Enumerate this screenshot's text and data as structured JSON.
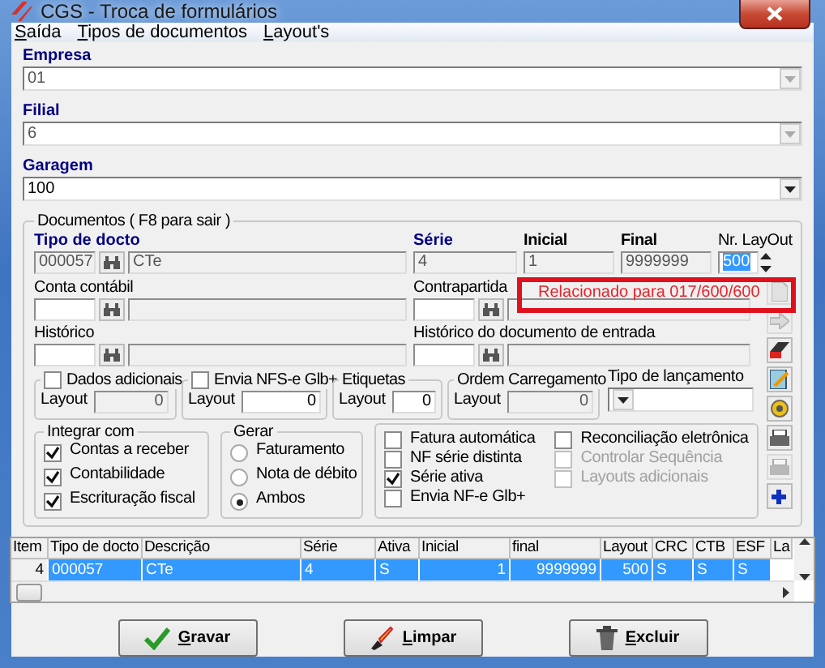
{
  "window": {
    "title": "CGS - Troca de formulários"
  },
  "menu": [
    {
      "label": "Saída"
    },
    {
      "label": "Tipos de documentos"
    },
    {
      "label": "Layout's"
    }
  ],
  "header_fields": [
    {
      "label": "Empresa",
      "value": "01",
      "disabled": true
    },
    {
      "label": "Filial",
      "value": "6",
      "disabled": true
    },
    {
      "label": "Garagem",
      "value": "100",
      "disabled": false
    }
  ],
  "documentos": {
    "title": "Documentos ( F8 para sair )",
    "tipo_docto": {
      "label": "Tipo de docto",
      "code": "000057",
      "description": "CTe"
    },
    "serie": {
      "label": "Série",
      "value": "4"
    },
    "inicial": {
      "label": "Inicial",
      "value": "1"
    },
    "final": {
      "label": "Final",
      "value": "9999999"
    },
    "nr_layout": {
      "label": "Nr. LayOut",
      "value": "500"
    },
    "notice": "Relacionado para 017/600/600",
    "conta_contabil": {
      "label": "Conta contábil"
    },
    "contrapartida": {
      "label": "Contrapartida"
    },
    "historico": {
      "label": "Histórico"
    },
    "historico_entrada": {
      "label": "Histórico do documento de entrada"
    },
    "layout_groups": [
      {
        "kind": "checkbox",
        "title": "Dados adicionais",
        "checked": false,
        "layout_label": "Layout",
        "value": "0",
        "disabled": true
      },
      {
        "kind": "checkbox",
        "title": "Envia NFS-e Glb+",
        "checked": false,
        "layout_label": "Layout",
        "value": "0",
        "disabled": false
      },
      {
        "kind": "plain",
        "title": "Etiquetas",
        "layout_label": "Layout",
        "value": "0",
        "disabled": false
      },
      {
        "kind": "plain",
        "title": "Ordem Carregamento",
        "layout_label": "Layout",
        "value": "0",
        "disabled": true
      }
    ],
    "tipo_lancamento": {
      "label": "Tipo de lançamento"
    },
    "integrar": {
      "title": "Integrar com",
      "items": [
        {
          "label": "Contas a receber",
          "checked": true
        },
        {
          "label": "Contabilidade",
          "checked": true
        },
        {
          "label": "Escrituração fiscal",
          "checked": true
        }
      ]
    },
    "gerar": {
      "title": "Gerar",
      "options": [
        {
          "label": "Faturamento",
          "selected": false
        },
        {
          "label": "Nota de débito",
          "selected": false
        },
        {
          "label": "Ambos",
          "selected": true
        }
      ]
    },
    "options": [
      [
        {
          "label": "Fatura automática",
          "checked": false,
          "disabled": false
        },
        {
          "label": "NF série distinta",
          "checked": false,
          "disabled": false
        },
        {
          "label": "Série ativa",
          "checked": true,
          "disabled": false
        },
        {
          "label": "Envia NF-e Glb+",
          "checked": false,
          "disabled": false
        }
      ],
      [
        {
          "label": "Reconciliação eletrônica",
          "checked": false,
          "disabled": false
        },
        {
          "label": "Controlar Sequência",
          "checked": false,
          "disabled": true
        },
        {
          "label": "Layouts adicionais",
          "checked": false,
          "disabled": true
        }
      ]
    ],
    "side_buttons": [
      {
        "kind": "document",
        "disabled": true
      },
      {
        "kind": "arrow",
        "disabled": true
      },
      {
        "kind": "eraser",
        "disabled": false
      },
      {
        "kind": "edit",
        "disabled": false
      },
      {
        "kind": "gear",
        "disabled": false
      },
      {
        "kind": "printer",
        "disabled": false
      },
      {
        "kind": "printer",
        "disabled": true
      },
      {
        "kind": "plus",
        "disabled": false
      }
    ]
  },
  "table": {
    "columns": [
      {
        "label": "Item",
        "numeric": true
      },
      {
        "label": "Tipo de docto",
        "numeric": false
      },
      {
        "label": "Descrição",
        "numeric": false
      },
      {
        "label": "Série",
        "numeric": false
      },
      {
        "label": "Ativa",
        "numeric": false
      },
      {
        "label": "Inicial",
        "numeric": true
      },
      {
        "label": "final",
        "numeric": true
      },
      {
        "label": "Layout",
        "numeric": true
      },
      {
        "label": "CRC",
        "numeric": false
      },
      {
        "label": "CTB",
        "numeric": false
      },
      {
        "label": "ESF",
        "numeric": false
      },
      {
        "label": "La"
      }
    ],
    "rows": [
      {
        "selected": true,
        "cells": [
          "4",
          "000057",
          "CTe",
          "4",
          "S",
          "1",
          "9999999",
          "500",
          "S",
          "S",
          "S"
        ]
      }
    ]
  },
  "buttons": [
    {
      "kind": "save",
      "label": "Gravar"
    },
    {
      "kind": "clear",
      "label": "Limpar"
    },
    {
      "kind": "delete",
      "label": "Excluir"
    }
  ]
}
